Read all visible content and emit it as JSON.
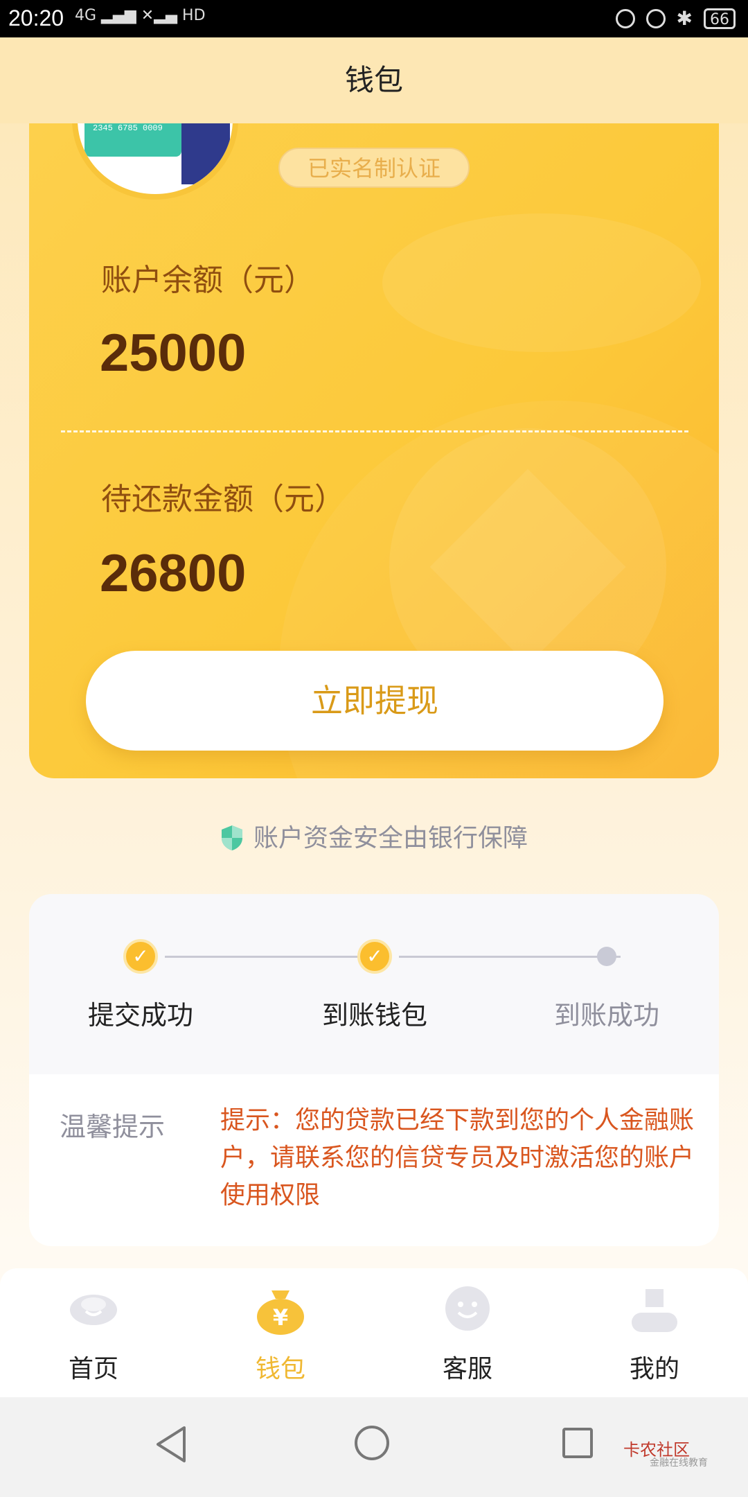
{
  "status_bar": {
    "time": "20:20",
    "signal": "4G ▂▄▆ ✕▂▄ HD",
    "battery": "66"
  },
  "header": {
    "title": "钱包"
  },
  "card": {
    "verified_badge": "已实名制认证",
    "avatar_card_number": "2345 6785 0009",
    "balance_label": "账户余额（元）",
    "balance_value": "25000",
    "repay_label": "待还款金额（元）",
    "repay_value": "26800",
    "withdraw_button": "立即提现"
  },
  "safety_note": "账户资金安全由银行保障",
  "progress": {
    "steps": [
      {
        "label": "提交成功",
        "done": true
      },
      {
        "label": "到账钱包",
        "done": true
      },
      {
        "label": "到账成功",
        "done": false
      }
    ]
  },
  "notice": {
    "title": "温馨提示",
    "text": "提示：您的贷款已经下款到您的个人金融账户，请联系您的信贷专员及时激活您的账户使用权限"
  },
  "tabbar": {
    "items": [
      {
        "label": "首页",
        "icon": "ingot-icon",
        "active": false
      },
      {
        "label": "钱包",
        "icon": "money-bag-icon",
        "active": true
      },
      {
        "label": "客服",
        "icon": "smiley-chat-icon",
        "active": false
      },
      {
        "label": "我的",
        "icon": "user-icon",
        "active": false
      }
    ]
  },
  "watermark": {
    "title": "卡农社区",
    "subtitle": "金融在线教育"
  },
  "colors": {
    "accent": "#fbbe2e",
    "active_tab": "#f0b832",
    "inactive_tab": "#222222",
    "notice_text": "#d9561f"
  }
}
